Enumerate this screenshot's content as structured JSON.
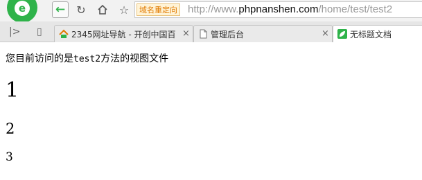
{
  "toolbar": {
    "logo_icon": "360-browser-logo-icon",
    "back_icon": "arrow-left-icon",
    "reload_icon": "reload-icon",
    "home_icon": "home-icon",
    "star_icon": "star-icon",
    "redirect_badge": "域名重定向",
    "url_scheme": "http://www.",
    "url_host": "phpnanshen.com",
    "url_path": "/home/test/test2"
  },
  "tabs": [
    {
      "title": "2345网址导航 - 开创中国百",
      "icon": "2345-favicon",
      "active": false
    },
    {
      "title": "管理后台",
      "icon": "page-icon",
      "active": false
    },
    {
      "title": "无标题文档",
      "icon": "leaf-favicon",
      "active": true
    }
  ],
  "page": {
    "intro_prefix": "您目前访问的是",
    "intro_code": "test2",
    "intro_suffix": "方法的视图文件",
    "heading1": "1",
    "heading2": "2",
    "heading3": "3"
  },
  "colors": {
    "accent_green": "#2fb34a",
    "redirect_orange": "#e07a00"
  }
}
